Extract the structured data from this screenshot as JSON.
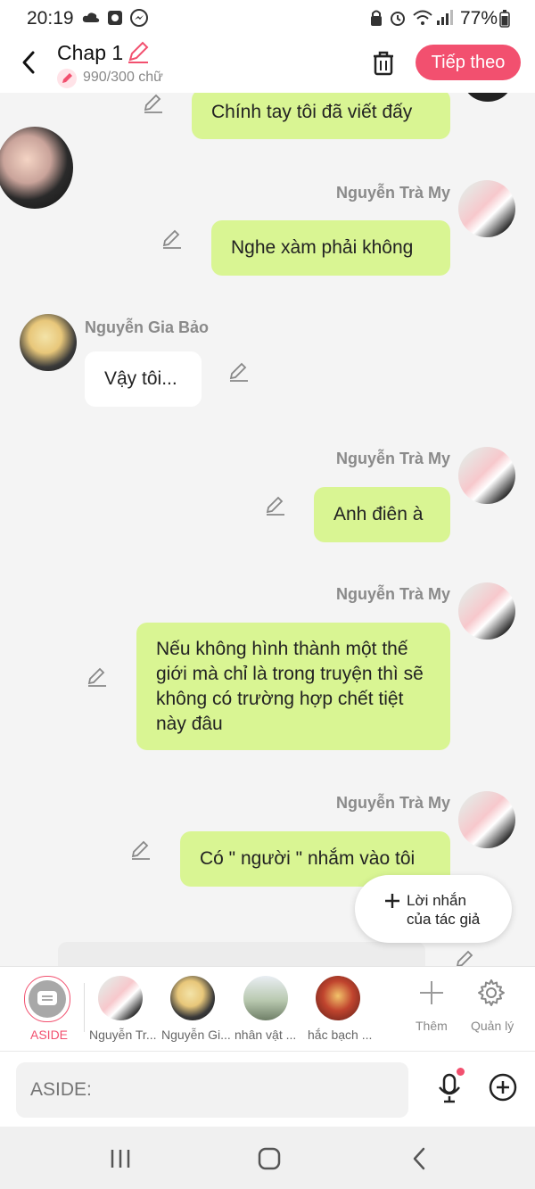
{
  "status_bar": {
    "time": "20:19",
    "battery": "77%"
  },
  "header": {
    "title": "Chap 1",
    "word_count": "990/300 chữ",
    "next_label": "Tiếp theo"
  },
  "messages": [
    {
      "text": "Chính tay tôi đã viết đấy",
      "sender": ""
    },
    {
      "text": "Nghe xàm phải không",
      "sender": "Nguyễn Trà My"
    },
    {
      "text": "Vậy tôi...",
      "sender": "Nguyễn Gia Bảo"
    },
    {
      "text": "Anh điên à",
      "sender": "Nguyễn Trà My"
    },
    {
      "text": "Nếu không hình thành một thế giới mà chỉ là trong truyện thì sẽ không có trường hợp chết tiệt này đâu",
      "sender": "Nguyễn Trà My"
    },
    {
      "text": "Có \" người \" nhắm vào tôi",
      "sender": "Nguyễn Trà My"
    }
  ],
  "float_button": {
    "line1": "Lời nhắn",
    "line2": "của tác giả"
  },
  "characters": [
    {
      "label": "ASIDE"
    },
    {
      "label": "Nguyễn Tr..."
    },
    {
      "label": "Nguyễn Gi..."
    },
    {
      "label": "nhân vật ..."
    },
    {
      "label": "hắc bạch ..."
    },
    {
      "label": "Thêm"
    },
    {
      "label": "Quản lý"
    }
  ],
  "input": {
    "placeholder": "ASIDE:"
  },
  "colors": {
    "accent": "#f2506f",
    "my_bubble": "#d9f593",
    "other_bubble": "#ffffff"
  }
}
